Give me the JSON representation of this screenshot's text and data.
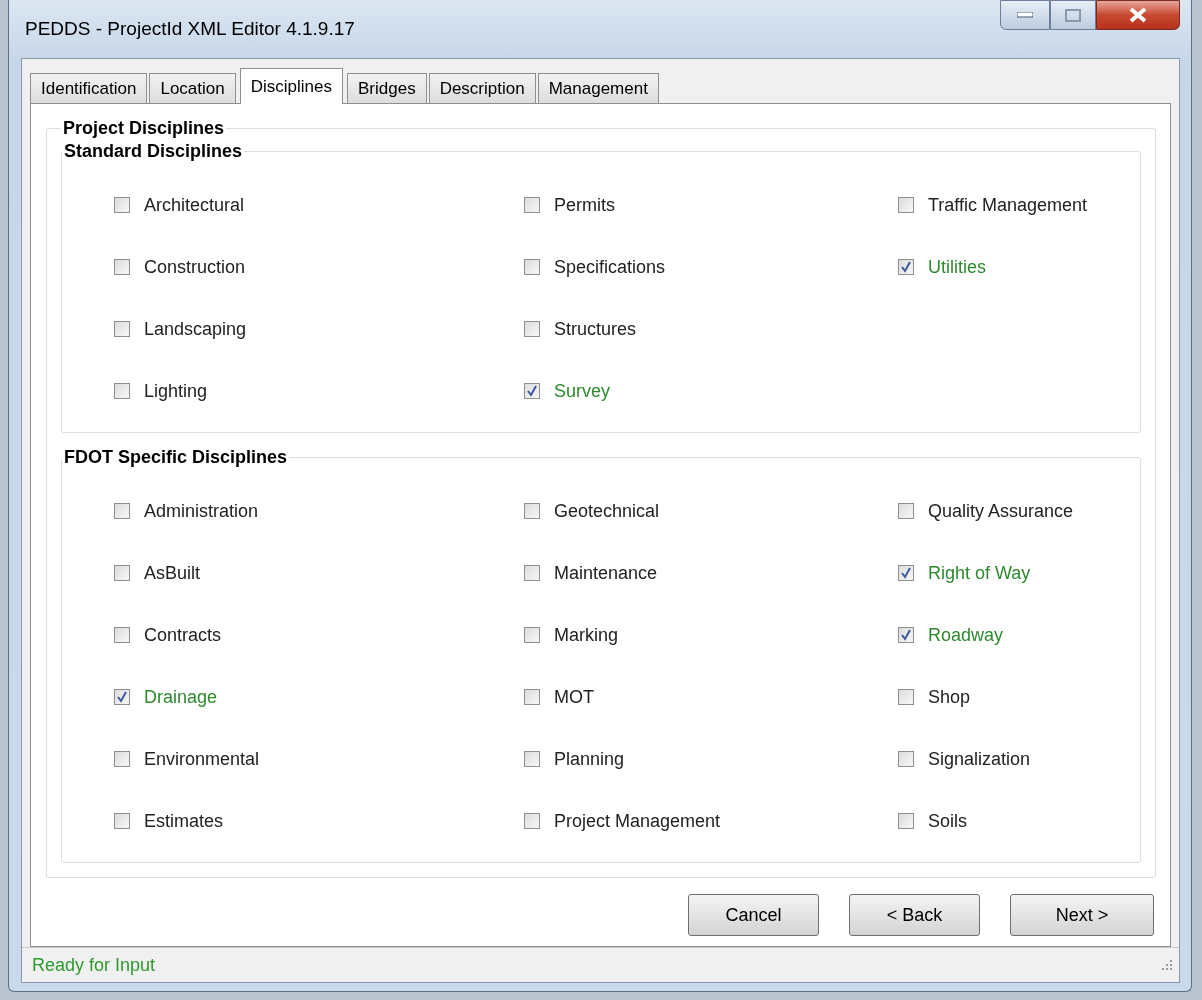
{
  "window": {
    "title": "PEDDS - ProjectId XML Editor 4.1.9.17"
  },
  "tabs": [
    {
      "label": "Identification",
      "selected": false
    },
    {
      "label": "Location",
      "selected": false
    },
    {
      "label": "Disciplines",
      "selected": true
    },
    {
      "label": "Bridges",
      "selected": false
    },
    {
      "label": "Description",
      "selected": false
    },
    {
      "label": "Management",
      "selected": false
    }
  ],
  "panel": {
    "title": "Project Disciplines",
    "groups": [
      {
        "title": "Standard Disciplines",
        "columns": [
          [
            {
              "label": "Architectural",
              "checked": false
            },
            {
              "label": "Construction",
              "checked": false
            },
            {
              "label": "Landscaping",
              "checked": false
            },
            {
              "label": "Lighting",
              "checked": false
            }
          ],
          [
            {
              "label": "Permits",
              "checked": false
            },
            {
              "label": "Specifications",
              "checked": false
            },
            {
              "label": "Structures",
              "checked": false
            },
            {
              "label": "Survey",
              "checked": true
            }
          ],
          [
            {
              "label": "Traffic Management",
              "checked": false
            },
            {
              "label": "Utilities",
              "checked": true
            }
          ]
        ]
      },
      {
        "title": "FDOT Specific Disciplines",
        "columns": [
          [
            {
              "label": "Administration",
              "checked": false
            },
            {
              "label": "AsBuilt",
              "checked": false
            },
            {
              "label": "Contracts",
              "checked": false
            },
            {
              "label": "Drainage",
              "checked": true
            },
            {
              "label": "Environmental",
              "checked": false
            },
            {
              "label": "Estimates",
              "checked": false
            }
          ],
          [
            {
              "label": "Geotechnical",
              "checked": false
            },
            {
              "label": "Maintenance",
              "checked": false
            },
            {
              "label": "Marking",
              "checked": false
            },
            {
              "label": "MOT",
              "checked": false
            },
            {
              "label": "Planning",
              "checked": false
            },
            {
              "label": "Project Management",
              "checked": false
            }
          ],
          [
            {
              "label": "Quality Assurance",
              "checked": false
            },
            {
              "label": "Right of Way",
              "checked": true
            },
            {
              "label": "Roadway",
              "checked": true
            },
            {
              "label": "Shop",
              "checked": false
            },
            {
              "label": "Signalization",
              "checked": false
            },
            {
              "label": "Soils",
              "checked": false
            }
          ]
        ]
      }
    ]
  },
  "buttons": [
    "Cancel",
    "< Back",
    "Next >"
  ],
  "status_bar": "Ready for Input"
}
